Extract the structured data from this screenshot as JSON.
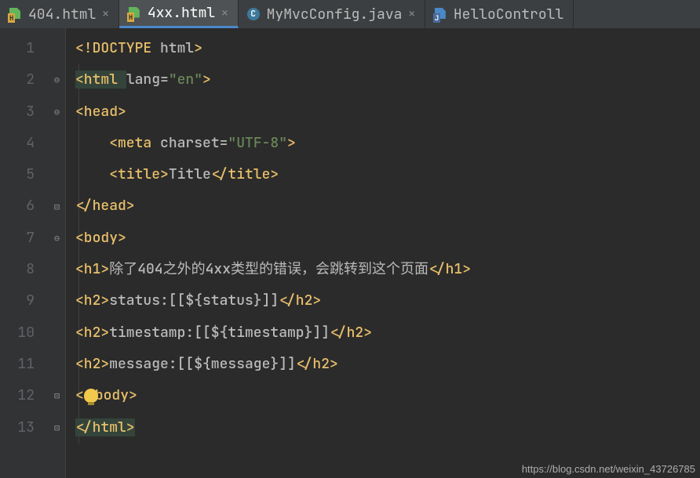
{
  "tabs": [
    {
      "name": "404.html",
      "icon": "html",
      "active": false,
      "closable": true
    },
    {
      "name": "4xx.html",
      "icon": "html",
      "active": true,
      "closable": true
    },
    {
      "name": "MyMvcConfig.java",
      "icon": "class",
      "active": false,
      "closable": true
    },
    {
      "name": "HelloControll",
      "icon": "java",
      "active": false,
      "closable": false
    }
  ],
  "gutter": {
    "start": 1,
    "end": 13
  },
  "fold_markers": {
    "2": "⊖",
    "3": "⊖",
    "6": "⊟",
    "7": "⊖",
    "12": "⊟",
    "13": "⊟"
  },
  "code": {
    "l1": {
      "doctype": "<!DOCTYPE ",
      "kw": "html",
      "close": ">"
    },
    "l2": {
      "open": "<html ",
      "attr": "lang=",
      "val": "\"en\"",
      "close": ">"
    },
    "l3": {
      "tag": "<head>"
    },
    "l4": {
      "open": "<meta ",
      "attr": "charset=",
      "val": "\"UTF-8\"",
      "close": ">"
    },
    "l5": {
      "open": "<title>",
      "text": "Title",
      "close": "</title>"
    },
    "l6": {
      "tag": "</head>"
    },
    "l7": {
      "tag": "<body>"
    },
    "l8": {
      "open": "<h1>",
      "text": "除了404之外的4xx类型的错误，会跳转到这个页面",
      "close": "</h1>"
    },
    "l9": {
      "open": "<h2>",
      "text": "status:[[${status}]]",
      "close": "</h2>"
    },
    "l10": {
      "open": "<h2>",
      "text": "timestamp:[[${timestamp}]]",
      "close": "</h2>"
    },
    "l11": {
      "open": "<h2>",
      "text": "message:[[${message}]]",
      "close": "</h2>"
    },
    "l12": {
      "pre": "<",
      "post": "body>"
    },
    "l13": {
      "tag": "</html>"
    }
  },
  "watermark": "https://blog.csdn.net/weixin_43726785"
}
